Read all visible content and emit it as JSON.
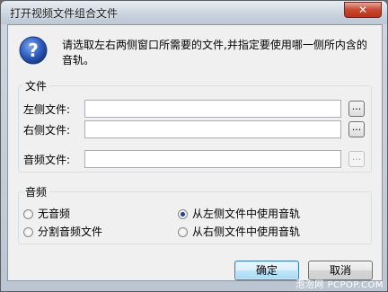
{
  "window": {
    "title": "打开视频文件组合文件",
    "close_glyph": "✕"
  },
  "message": "请选取左右两侧窗口所需要的文件,并指定要使用哪一侧所内含的音轨。",
  "files_group": {
    "label": "文件",
    "left_label": "左侧文件:",
    "right_label": "右侧文件:",
    "audio_label": "音频文件:",
    "left_value": "",
    "right_value": "",
    "audio_value": "",
    "browse_label": "...",
    "audio_browse_enabled": false
  },
  "audio_group": {
    "label": "音频",
    "options": [
      {
        "label": "无音频",
        "checked": false
      },
      {
        "label": "分割音频文件",
        "checked": false
      },
      {
        "label": "从左侧文件中使用音轨",
        "checked": true
      },
      {
        "label": "从右侧文件中使用音轨",
        "checked": false
      }
    ]
  },
  "buttons": {
    "ok": "确定",
    "cancel": "取消"
  },
  "watermark": "泡泡网 PCPOP.COM",
  "icons": {
    "question": "question-icon",
    "close": "close-icon"
  }
}
